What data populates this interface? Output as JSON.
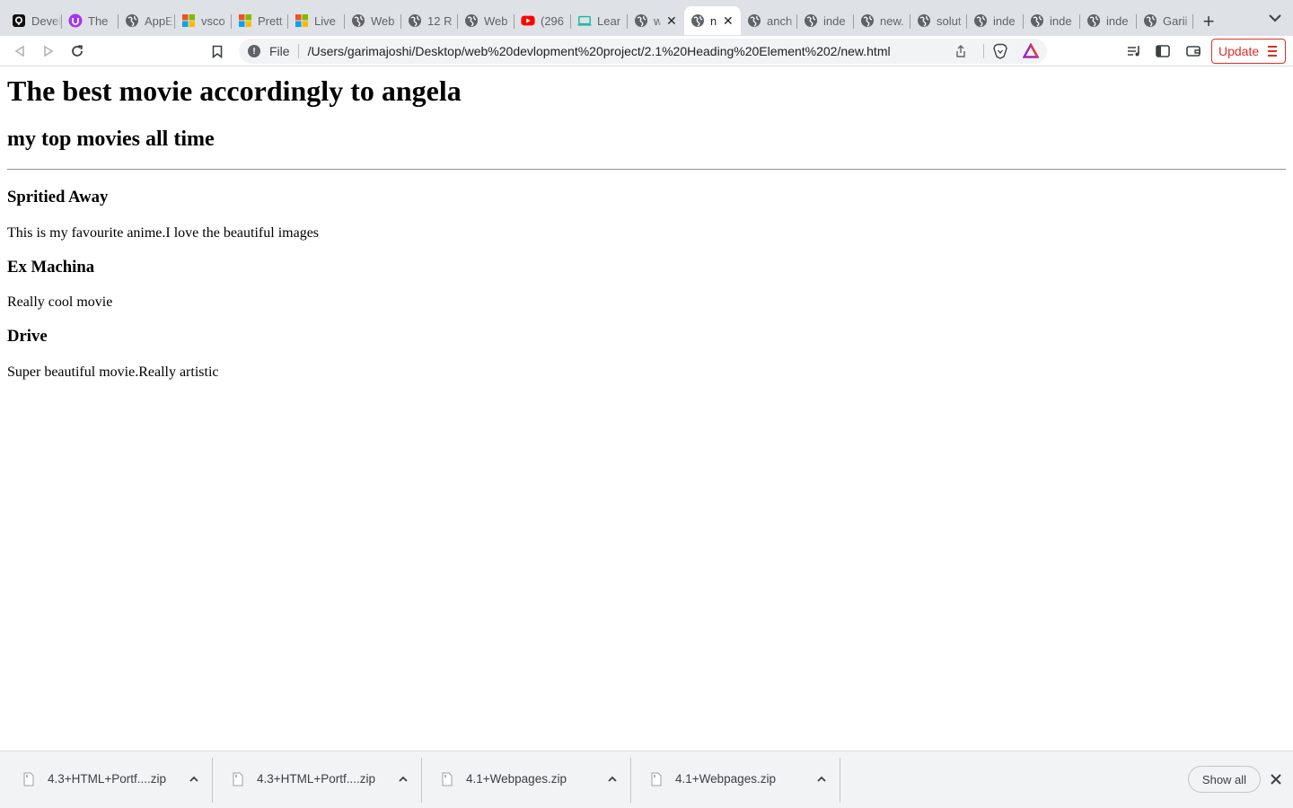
{
  "browser": {
    "tabs": [
      {
        "title": "Devel",
        "icon": "github-icon"
      },
      {
        "title": "The",
        "icon": "udemy-icon"
      },
      {
        "title": "AppE",
        "icon": "globe-icon"
      },
      {
        "title": "vsco",
        "icon": "microsoft-icon"
      },
      {
        "title": "Prett",
        "icon": "microsoft-icon"
      },
      {
        "title": "Live",
        "icon": "microsoft-icon"
      },
      {
        "title": "Web",
        "icon": "globe-icon"
      },
      {
        "title": "12 R",
        "icon": "globe-icon"
      },
      {
        "title": "Web",
        "icon": "globe-icon"
      },
      {
        "title": "(296",
        "icon": "youtube-icon"
      },
      {
        "title": "Lear",
        "icon": "learn-icon"
      },
      {
        "title": "w",
        "icon": "globe-icon"
      },
      {
        "title": "n",
        "icon": "globe-icon"
      },
      {
        "title": "anch",
        "icon": "globe-icon"
      },
      {
        "title": "inde",
        "icon": "globe-icon"
      },
      {
        "title": "new.",
        "icon": "globe-icon"
      },
      {
        "title": "solut",
        "icon": "globe-icon"
      },
      {
        "title": "inde",
        "icon": "globe-icon"
      },
      {
        "title": "inde",
        "icon": "globe-icon"
      },
      {
        "title": "inde",
        "icon": "globe-icon"
      },
      {
        "title": "Garii",
        "icon": "globe-icon"
      }
    ],
    "active_tab_index": 12,
    "new_tab_label": "+",
    "omnibox": {
      "scheme_label": "File",
      "url": "/Users/garimajoshi/Desktop/web%20devlopment%20project/2.1%20Heading%20Element%202/new.html"
    },
    "update_label": "Update",
    "colors": {
      "accent_red": "#d93025",
      "tab_strip": "#dee1e6",
      "shelf": "#f1f3f4"
    }
  },
  "page": {
    "h1": "The best movie accordingly to angela",
    "h2": "my top movies all time",
    "movies": [
      {
        "title": "Spritied Away",
        "desc": "This is my favourite anime.I love the beautiful images"
      },
      {
        "title": "Ex Machina",
        "desc": "Really cool movie"
      },
      {
        "title": "Drive",
        "desc": "Super beautiful movie.Really artistic"
      }
    ]
  },
  "downloads": {
    "items": [
      {
        "name": "4.3+HTML+Portf....zip"
      },
      {
        "name": "4.3+HTML+Portf....zip"
      },
      {
        "name": "4.1+Webpages.zip"
      },
      {
        "name": "4.1+Webpages.zip"
      }
    ],
    "show_all_label": "Show all"
  }
}
